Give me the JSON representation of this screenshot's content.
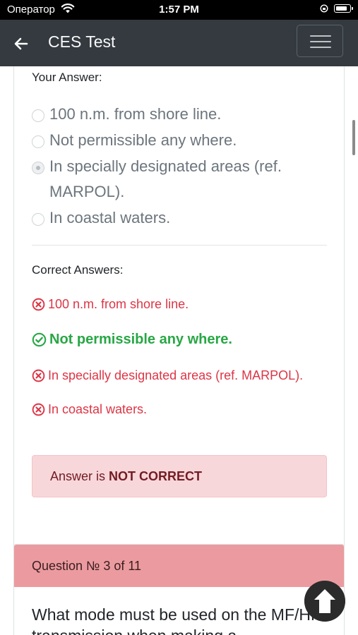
{
  "status_bar": {
    "carrier": "Оператор",
    "time": "1:57 PM"
  },
  "navbar": {
    "title": "CES Test"
  },
  "your_answer": {
    "label": "Your Answer:",
    "options": [
      {
        "text": "100 n.m. from shore line.",
        "selected": false
      },
      {
        "text": "Not permissible any where.",
        "selected": false
      },
      {
        "text_line1": "In specially designated areas (ref.",
        "text_line2": "MARPOL).",
        "selected": true
      },
      {
        "text": "In coastal waters.",
        "selected": false
      }
    ]
  },
  "correct_answers": {
    "label": "Correct Answers:",
    "items": [
      {
        "text": "100 n.m. from shore line.",
        "status": "wrong"
      },
      {
        "text": "Not permissible any where.",
        "status": "correct"
      },
      {
        "text": "In specially designated areas (ref. MARPOL).",
        "status": "wrong"
      },
      {
        "text": "In coastal waters.",
        "status": "wrong"
      }
    ]
  },
  "result": {
    "prefix": "Answer is",
    "verdict": "NOT CORRECT"
  },
  "next_question": {
    "header": "Question № 3 of 11",
    "text": "What mode must be used on the MF/HF transmission when making a"
  },
  "colors": {
    "navbar": "#343a40",
    "wrong": "#dc3545",
    "correct": "#28a745",
    "alert_bg": "#f8d7da",
    "question_header": "#eb9b9f"
  },
  "icons": {
    "back": "arrow-left-icon",
    "menu": "hamburger-icon",
    "wrong": "x-circle-icon",
    "correct": "check-circle-icon",
    "scroll_top": "arrow-up-circle-icon"
  }
}
